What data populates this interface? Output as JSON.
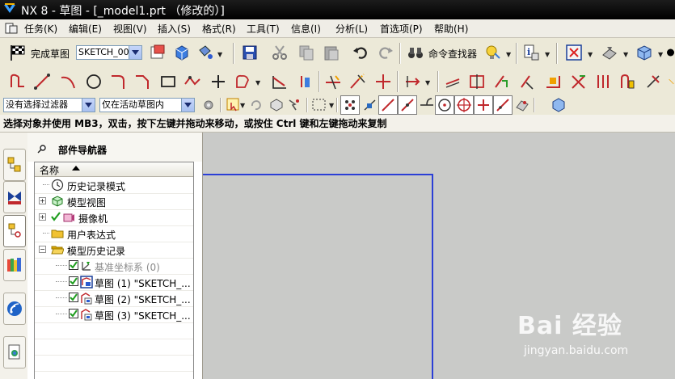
{
  "window": {
    "title": "NX 8 - 草图 - [_model1.prt （修改的）]"
  },
  "menu": {
    "items": [
      {
        "label": "任务(K)"
      },
      {
        "label": "编辑(E)"
      },
      {
        "label": "视图(V)"
      },
      {
        "label": "插入(S)"
      },
      {
        "label": "格式(R)"
      },
      {
        "label": "工具(T)"
      },
      {
        "label": "信息(I)"
      },
      {
        "label": "分析(L)"
      },
      {
        "label": "首选项(P)"
      },
      {
        "label": "帮助(H)"
      }
    ]
  },
  "toolbar1": {
    "finish_sketch_label": "完成草图",
    "sketch_name": "SKETCH_000",
    "command_finder_label": "命令查找器"
  },
  "toolbar3": {
    "filter_value": "没有选择过滤器",
    "scope_value": "仅在活动草图内"
  },
  "status": {
    "prompt": "选择对象并使用 MB3，双击，按下左键并拖动来移动，或按住 Ctrl 键和左键拖动来复制"
  },
  "navigator": {
    "title": "部件导航器",
    "column_name": "名称",
    "rows": [
      {
        "label": "历史记录模式",
        "icon": "clock-icon"
      },
      {
        "label": "模型视图",
        "icon": "model-views-icon"
      },
      {
        "label": "摄像机",
        "icon": "camera-icon"
      },
      {
        "label": "用户表达式",
        "icon": "folder-icon"
      },
      {
        "label": "模型历史记录",
        "icon": "folder-open-icon"
      },
      {
        "label": "基准坐标系 (0)",
        "icon": "datum-csys-icon"
      },
      {
        "label": "草图 (1) \"SKETCH_...",
        "icon": "sketch-icon"
      },
      {
        "label": "草图 (2) \"SKETCH_...",
        "icon": "sketch-icon"
      },
      {
        "label": "草图 (3) \"SKETCH_...",
        "icon": "sketch-icon"
      }
    ]
  },
  "watermark": {
    "brand": "Bai 经验",
    "site": "jingyan.baidu.com"
  },
  "colors": {
    "sketch_line": "#2b3fd6",
    "graphics_bg": "#c9cac8",
    "check_green": "#1e9d1e"
  }
}
